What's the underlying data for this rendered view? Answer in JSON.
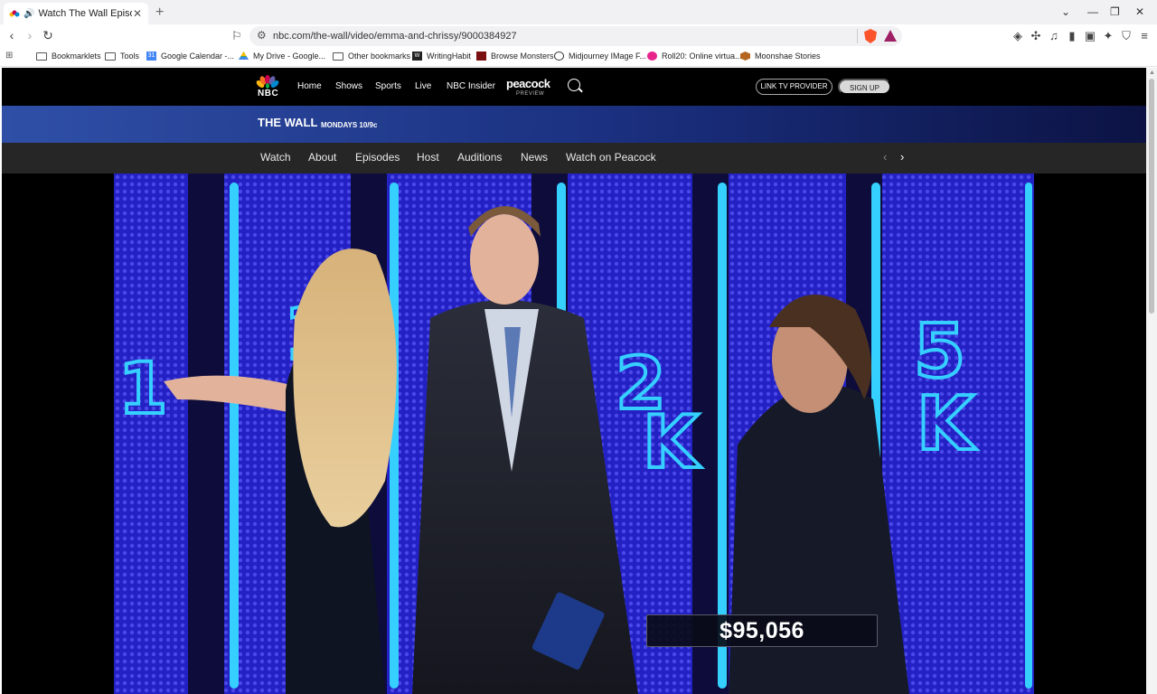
{
  "browser": {
    "tab_title": "Watch The Wall Episode: Emma and Chrissy",
    "url": "nbc.com/the-wall/video/emma-and-chrissy/9000384927",
    "bookmarks": [
      "Bookmarklets",
      "Tools",
      "Google Calendar -...",
      "My Drive - Google...",
      "Other bookmarks",
      "WritingHabit",
      "Browse Monsters",
      "Midjourney IMage F...",
      "Roll20: Online virtua...",
      "Moonshae Stories"
    ]
  },
  "nbc": {
    "logo": "NBC",
    "nav": [
      "Home",
      "Shows",
      "Sports",
      "Live",
      "NBC Insider"
    ],
    "peacock": "peacock",
    "peacock_sub": "PREVIEW",
    "link_provider": "LINK TV PROVIDER",
    "sign_up": "SIGN UP"
  },
  "show": {
    "title": "THE WALL",
    "schedule": "MONDAYS 10/9c",
    "tabs": [
      "Watch",
      "About",
      "Episodes",
      "Host",
      "Auditions",
      "News",
      "Watch on Peacock"
    ]
  },
  "video": {
    "wall_labels": [
      "1",
      "1",
      "2",
      "5",
      "K",
      "5",
      "K"
    ],
    "score": "$95,056"
  },
  "colors": {
    "accent_blue": "#2f4fa7",
    "wall_blue": "#1b1aa8",
    "neon": "#35d0ff"
  }
}
